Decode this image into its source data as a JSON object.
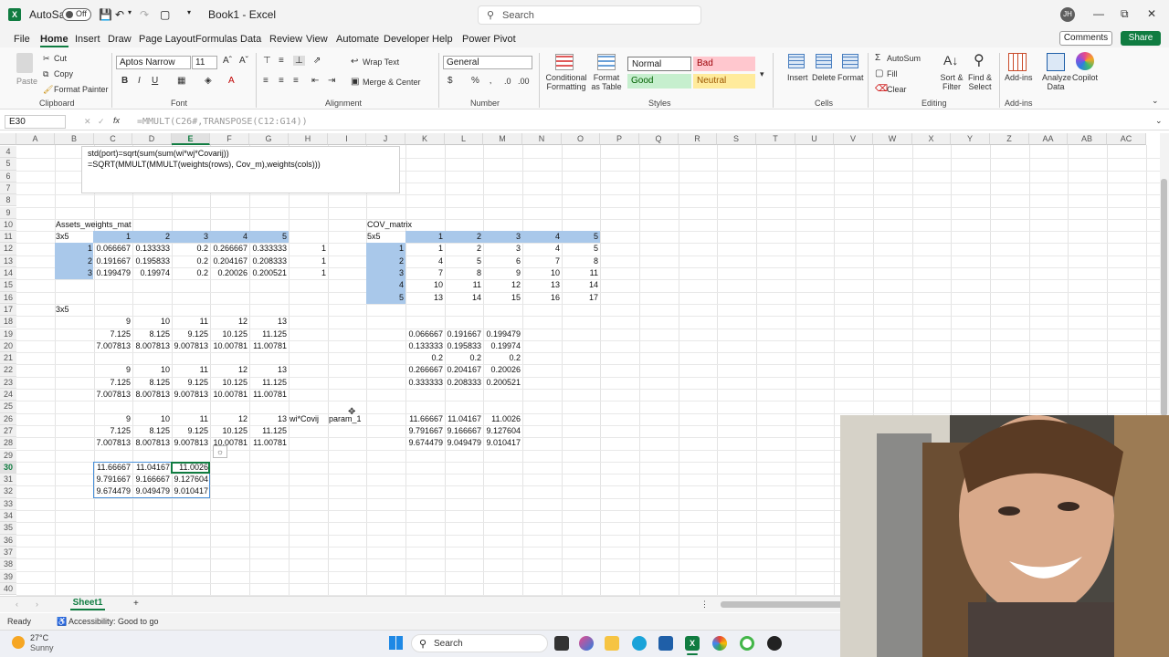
{
  "titlebar": {
    "autosave_label": "AutoSave",
    "autosave_state": "Off",
    "window_title": "Book1 - Excel",
    "search_placeholder": "Search",
    "user_initials": "JH"
  },
  "menu": {
    "tabs": [
      "File",
      "Home",
      "Insert",
      "Draw",
      "Page Layout",
      "Formulas",
      "Data",
      "Review",
      "View",
      "Automate",
      "Developer",
      "Help",
      "Power Pivot"
    ],
    "active": "Home",
    "comments_label": "Comments",
    "share_label": "Share"
  },
  "ribbon": {
    "clipboard": {
      "paste": "Paste",
      "cut": "Cut",
      "copy": "Copy",
      "format_painter": "Format Painter",
      "group": "Clipboard"
    },
    "font": {
      "name": "Aptos Narrow",
      "size": "11",
      "group": "Font"
    },
    "alignment": {
      "wrap_text": "Wrap Text",
      "merge_center": "Merge & Center",
      "group": "Alignment"
    },
    "number": {
      "format": "General",
      "group": "Number"
    },
    "styles": {
      "conditional_formatting": "Conditional Formatting",
      "format_as_table": "Format as Table",
      "normal": "Normal",
      "bad": "Bad",
      "good": "Good",
      "neutral": "Neutral",
      "group": "Styles"
    },
    "cells": {
      "insert": "Insert",
      "delete": "Delete",
      "format": "Format",
      "group": "Cells"
    },
    "editing": {
      "autosum": "AutoSum",
      "fill": "Fill",
      "clear": "Clear",
      "sort_filter": "Sort & Filter",
      "find_select": "Find & Select",
      "group": "Editing"
    },
    "addins": {
      "addins": "Add-ins",
      "analyze_data": "Analyze Data",
      "copilot": "Copilot",
      "group": "Add-ins"
    }
  },
  "formula_bar": {
    "name_box": "E30",
    "fx": "fx",
    "formula": "=MMULT(C26#,TRANSPOSE(C12:G14))"
  },
  "columns": [
    "A",
    "B",
    "C",
    "D",
    "E",
    "F",
    "G",
    "H",
    "I",
    "J",
    "K",
    "L",
    "M",
    "N",
    "O",
    "P",
    "Q",
    "R",
    "S",
    "T",
    "U",
    "V",
    "W",
    "X",
    "Y",
    "Z",
    "AA",
    "AB",
    "AC"
  ],
  "selected_column": "E",
  "rows": [
    "4",
    "5",
    "6",
    "7",
    "8",
    "9",
    "10",
    "11",
    "12",
    "13",
    "14",
    "15",
    "16",
    "17",
    "18",
    "19",
    "20",
    "21",
    "22",
    "23",
    "24",
    "25",
    "26",
    "27",
    "28",
    "29",
    "30",
    "31",
    "32",
    "33",
    "34",
    "35",
    "36",
    "37",
    "38",
    "39",
    "40"
  ],
  "selected_row": "30",
  "textbox": {
    "line1": "std(port)=sqrt(sum(sum(wi*wj*Covarij))",
    "line2": "=SQRT(MMULT(MMULT(weights(rows), Cov_m),weights(cols)))"
  },
  "cells": {
    "b10": "Assets_weights_mat",
    "b11": "3x5",
    "j10": "COV_matrix",
    "j11": "5x5",
    "b17": "3x5",
    "h26": "wi*Covij",
    "i26": "param_1",
    "weights_header": [
      "1",
      "2",
      "3",
      "4",
      "5"
    ],
    "weights_rows": [
      {
        "idx": "1",
        "vals": [
          "0.066667",
          "0.133333",
          "0.2",
          "0.266667",
          "0.333333"
        ],
        "h": "1"
      },
      {
        "idx": "2",
        "vals": [
          "0.191667",
          "0.195833",
          "0.2",
          "0.204167",
          "0.208333"
        ],
        "h": "1"
      },
      {
        "idx": "3",
        "vals": [
          "0.199479",
          "0.19974",
          "0.2",
          "0.20026",
          "0.200521"
        ],
        "h": "1"
      }
    ],
    "cov_header": [
      "1",
      "2",
      "3",
      "4",
      "5"
    ],
    "cov_rows": [
      {
        "idx": "1",
        "vals": [
          "1",
          "2",
          "3",
          "4",
          "5"
        ]
      },
      {
        "idx": "2",
        "vals": [
          "4",
          "5",
          "6",
          "7",
          "8"
        ]
      },
      {
        "idx": "3",
        "vals": [
          "7",
          "8",
          "9",
          "10",
          "11"
        ]
      },
      {
        "idx": "4",
        "vals": [
          "10",
          "11",
          "12",
          "13",
          "14"
        ]
      },
      {
        "idx": "5",
        "vals": [
          "13",
          "14",
          "15",
          "16",
          "17"
        ]
      }
    ],
    "block18": [
      [
        "9",
        "10",
        "11",
        "12",
        "13"
      ],
      [
        "7.125",
        "8.125",
        "9.125",
        "10.125",
        "11.125"
      ],
      [
        "7.007813",
        "8.007813",
        "9.007813",
        "10.00781",
        "11.00781"
      ]
    ],
    "block22": [
      [
        "9",
        "10",
        "11",
        "12",
        "13"
      ],
      [
        "7.125",
        "8.125",
        "9.125",
        "10.125",
        "11.125"
      ],
      [
        "7.007813",
        "8.007813",
        "9.007813",
        "10.00781",
        "11.00781"
      ]
    ],
    "block26": [
      [
        "9",
        "10",
        "11",
        "12",
        "13"
      ],
      [
        "7.125",
        "8.125",
        "9.125",
        "10.125",
        "11.125"
      ],
      [
        "7.007813",
        "8.007813",
        "9.007813",
        "10.00781",
        "11.00781"
      ]
    ],
    "transpose19": [
      [
        "0.066667",
        "0.191667",
        "0.199479"
      ],
      [
        "0.133333",
        "0.195833",
        "0.19974"
      ],
      [
        "0.2",
        "0.2",
        "0.2"
      ],
      [
        "0.266667",
        "0.204167",
        "0.20026"
      ],
      [
        "0.333333",
        "0.208333",
        "0.200521"
      ]
    ],
    "k26": [
      [
        "11.66667",
        "11.04167",
        "11.0026"
      ],
      [
        "9.791667",
        "9.166667",
        "9.127604"
      ],
      [
        "9.674479",
        "9.049479",
        "9.010417"
      ]
    ],
    "c30": [
      [
        "11.66667",
        "11.04167",
        "11.0026"
      ],
      [
        "9.791667",
        "9.166667",
        "9.127604"
      ],
      [
        "9.674479",
        "9.049479",
        "9.010417"
      ]
    ]
  },
  "sheet": {
    "name": "Sheet1",
    "add": "+"
  },
  "status": {
    "ready": "Ready",
    "accessibility": "Accessibility: Good to go"
  },
  "taskbar": {
    "temp": "27°C",
    "weather": "Sunny",
    "search": "Search"
  },
  "colors": {
    "excel_green": "#107c41",
    "header_blue": "#a9c8ea",
    "bad_bg": "#ffc7ce",
    "good_bg": "#c6efce",
    "neutral_bg": "#ffeb9c"
  }
}
